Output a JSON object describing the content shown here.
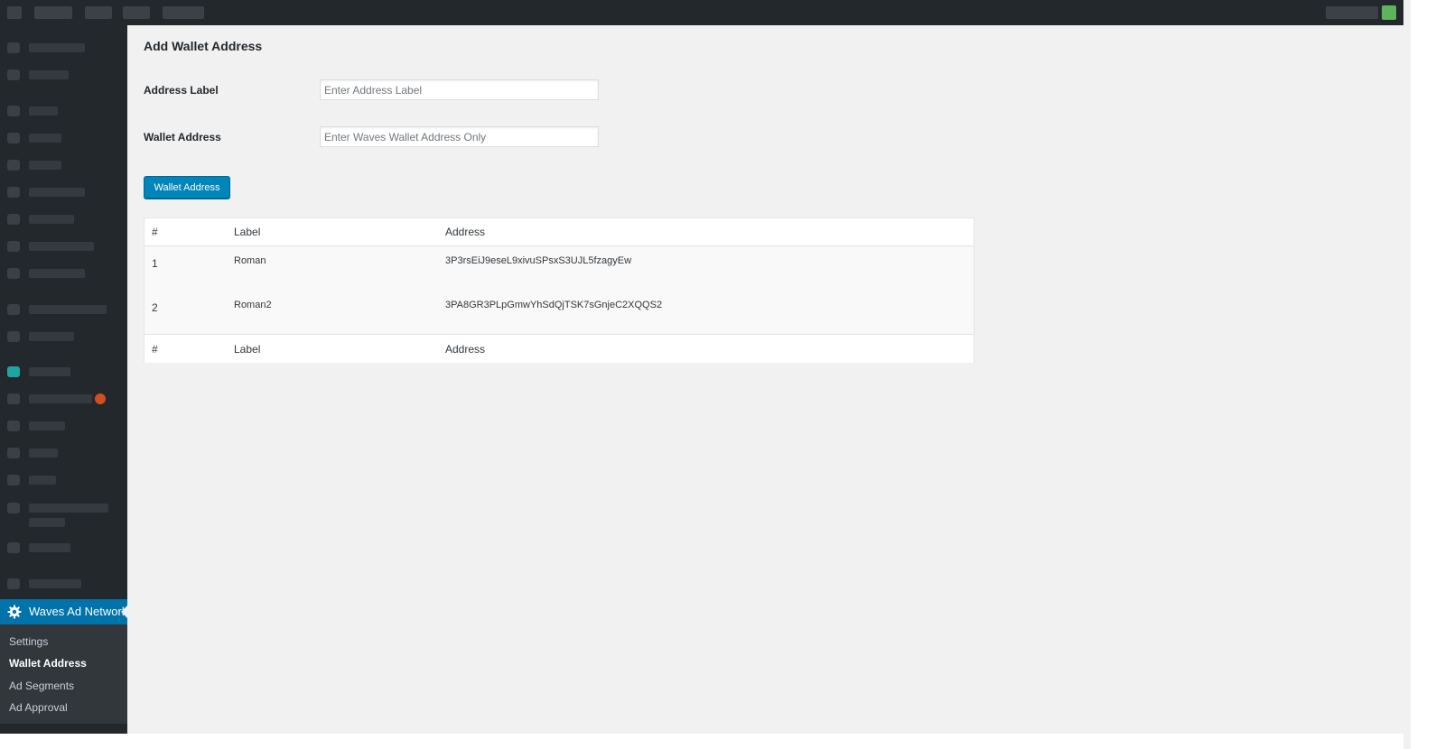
{
  "sidebar": {
    "active_menu_label": "Waves Ad Network",
    "submenu": [
      {
        "label": "Settings"
      },
      {
        "label": "Wallet Address"
      },
      {
        "label": "Ad Segments"
      },
      {
        "label": "Ad Approval"
      }
    ]
  },
  "page": {
    "title": "Add Wallet Address"
  },
  "form": {
    "address_label": {
      "label": "Address Label",
      "placeholder": "Enter Address Label",
      "value": ""
    },
    "wallet_address": {
      "label": "Wallet Address",
      "placeholder": "Enter Waves Wallet Address Only",
      "value": ""
    },
    "submit_label": "Wallet Address"
  },
  "table": {
    "columns": [
      "#",
      "Label",
      "Address"
    ],
    "rows": [
      {
        "num": "1",
        "label": "Roman",
        "address": "3P3rsEiJ9eseL9xivuSPsxS3UJL5fzagyEw"
      },
      {
        "num": "2",
        "label": "Roman2",
        "address": "3PA8GR3PLpGmwYhSdQjTSK7sGnjeC2XQQS2"
      }
    ]
  },
  "colors": {
    "accent": "#0073aa",
    "button": "#0085ba",
    "sidebar_bg": "#23282d",
    "content_bg": "#f1f1f1"
  }
}
